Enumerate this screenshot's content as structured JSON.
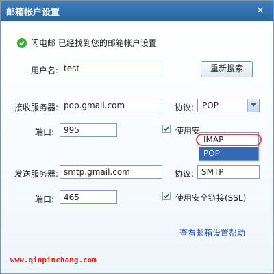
{
  "window": {
    "title": "邮箱帐户设置",
    "close_glyph": "×"
  },
  "status": {
    "text": "闪电邮 已经找到您的邮箱帐户设置"
  },
  "username": {
    "label": "用户名:",
    "value": "test"
  },
  "research_button": "重新搜索",
  "incoming": {
    "server_label": "接收服务器:",
    "server_value": "pop.gmail.com",
    "protocol_label": "协议:",
    "protocol_selected": "POP",
    "protocol_options": [
      "IMAP",
      "POP"
    ],
    "port_label": "端口:",
    "port_value": "995",
    "ssl_label": "使用安"
  },
  "outgoing": {
    "server_label": "发送服务器:",
    "server_value": "smtp.gmail.com",
    "protocol_label": "协议:",
    "protocol_value": "SMTP",
    "port_label": "端口:",
    "port_value": "465",
    "ssl_label": "使用安全链接(SSL)"
  },
  "help_link": "查看邮箱设置帮助",
  "watermark": "www.qinpinchang.com",
  "colors": {
    "titlebar": "#2f6bab",
    "highlight": "#3369b5",
    "annotation": "#d44a4a",
    "watermark": "#e0241c"
  }
}
